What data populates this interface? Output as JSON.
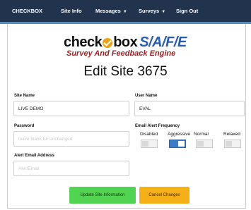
{
  "nav": {
    "brand": "CHECKBOX",
    "site_info": "Site Info",
    "messages": "Messages",
    "surveys": "Surveys",
    "sign_out": "Sign Out"
  },
  "logo": {
    "word1": "check",
    "word2": "box",
    "word3": "S/A/F/E",
    "tagline": "Survey And Feedback Engine"
  },
  "page": {
    "title": "Edit Site 3675"
  },
  "form": {
    "site_name": {
      "label": "Site Name",
      "value": "LIVE DEMO"
    },
    "user_name": {
      "label": "User Name",
      "value": "EVAL"
    },
    "password": {
      "label": "Password",
      "placeholder": "leave blank for unchanged"
    },
    "alert_email": {
      "label": "Alert Email Address",
      "placeholder": "AlertEmail"
    },
    "frequency": {
      "label": "Email Alert Frequency",
      "options": [
        {
          "label": "Disabled",
          "selected": false
        },
        {
          "label": "Aggressive",
          "selected": true
        },
        {
          "label": "Normal",
          "selected": false
        },
        {
          "label": "Relaxed",
          "selected": false
        }
      ]
    }
  },
  "buttons": {
    "update": "Update Site Information",
    "cancel": "Cancel Changes"
  },
  "colors": {
    "navbar": "#22334d",
    "nav_border": "#4a8fcf",
    "toggle_on": "#3b7cc8",
    "update_button": "#52d352",
    "cancel_button": "#f5b018",
    "logo_safe": "#2a5db0",
    "logo_tagline": "#9a1f1f"
  }
}
